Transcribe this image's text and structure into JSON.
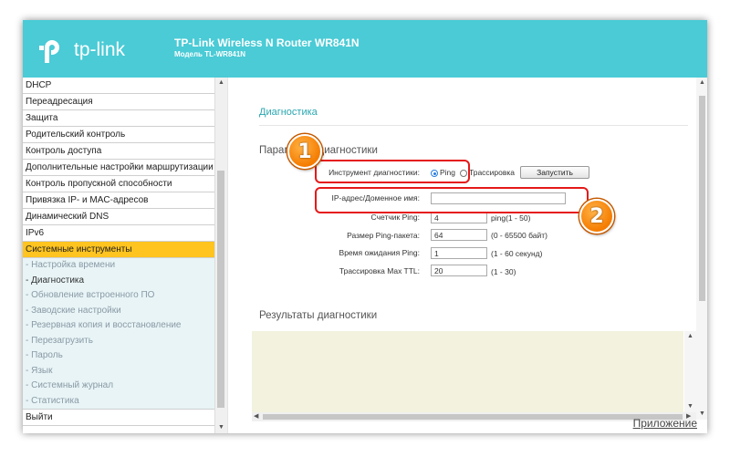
{
  "header": {
    "logo_text": "tp-link",
    "title": "TP-Link Wireless N Router WR841N",
    "model": "Модель TL-WR841N",
    "brand_color": "#4acbd6"
  },
  "sidebar": {
    "items_top": [
      {
        "label": "DHCP"
      },
      {
        "label": "Переадресация"
      },
      {
        "label": "Защита"
      },
      {
        "label": "Родительский контроль"
      },
      {
        "label": "Контроль доступа"
      },
      {
        "label": "Дополнительные настройки маршрутизации"
      },
      {
        "label": "Контроль пропускной способности"
      },
      {
        "label": "Привязка IP- и MAC-адресов"
      },
      {
        "label": "Динамический DNS"
      },
      {
        "label": "IPv6"
      },
      {
        "label": "Системные инструменты"
      }
    ],
    "sub_items": [
      {
        "label": "- Настройка времени"
      },
      {
        "label": "- Диагностика"
      },
      {
        "label": "- Обновление встроенного ПО"
      },
      {
        "label": "- Заводские настройки"
      },
      {
        "label": "- Резервная копия и восстановление"
      },
      {
        "label": "- Перезагрузить"
      },
      {
        "label": "- Пароль"
      },
      {
        "label": "- Язык"
      },
      {
        "label": "- Системный журнал"
      },
      {
        "label": "- Статистика"
      }
    ],
    "logout": "Выйти",
    "active_color": "#ffc41f"
  },
  "content": {
    "page_heading": "Диагностика",
    "params_title": "Параметры диагностики",
    "tool_label": "Инструмент диагностики:",
    "ping_label": "Ping",
    "traceroute_label": "Трассировка",
    "start_button": "Запустить",
    "ip_label": "IP-адрес/Доменное имя:",
    "ip_value": "",
    "count_label": "Счетчик Ping:",
    "count_value": "4",
    "count_hint": "ping(1 - 50)",
    "size_label": "Размер Ping-пакета:",
    "size_value": "64",
    "size_hint": "(0 - 65500 байт)",
    "timeout_label": "Время ожидания Ping:",
    "timeout_value": "1",
    "timeout_hint": "(1 - 60 секунд)",
    "ttl_label": "Трассировка Max TTL:",
    "ttl_value": "20",
    "ttl_hint": "(1 - 30)",
    "results_title": "Результаты диагностики",
    "footer_link": "Приложение"
  },
  "annotations": {
    "badge1": "1",
    "badge2": "2",
    "callout_color": "#e51919"
  }
}
